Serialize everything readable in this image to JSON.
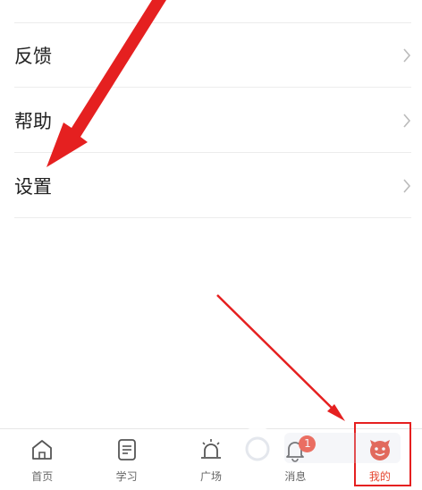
{
  "menu": {
    "items": [
      {
        "label": "反馈"
      },
      {
        "label": "帮助"
      },
      {
        "label": "设置"
      }
    ]
  },
  "tabbar": {
    "tabs": [
      {
        "label": "首页",
        "icon": "home-icon"
      },
      {
        "label": "学习",
        "icon": "document-icon"
      },
      {
        "label": "广场",
        "icon": "alarm-light-icon"
      },
      {
        "label": "消息",
        "icon": "bell-icon",
        "badge": "1"
      },
      {
        "label": "我的",
        "icon": "profile-icon",
        "active": true
      }
    ]
  },
  "colors": {
    "accent": "#e5452f",
    "arrow": "#e52020",
    "badge": "#f04a36"
  }
}
